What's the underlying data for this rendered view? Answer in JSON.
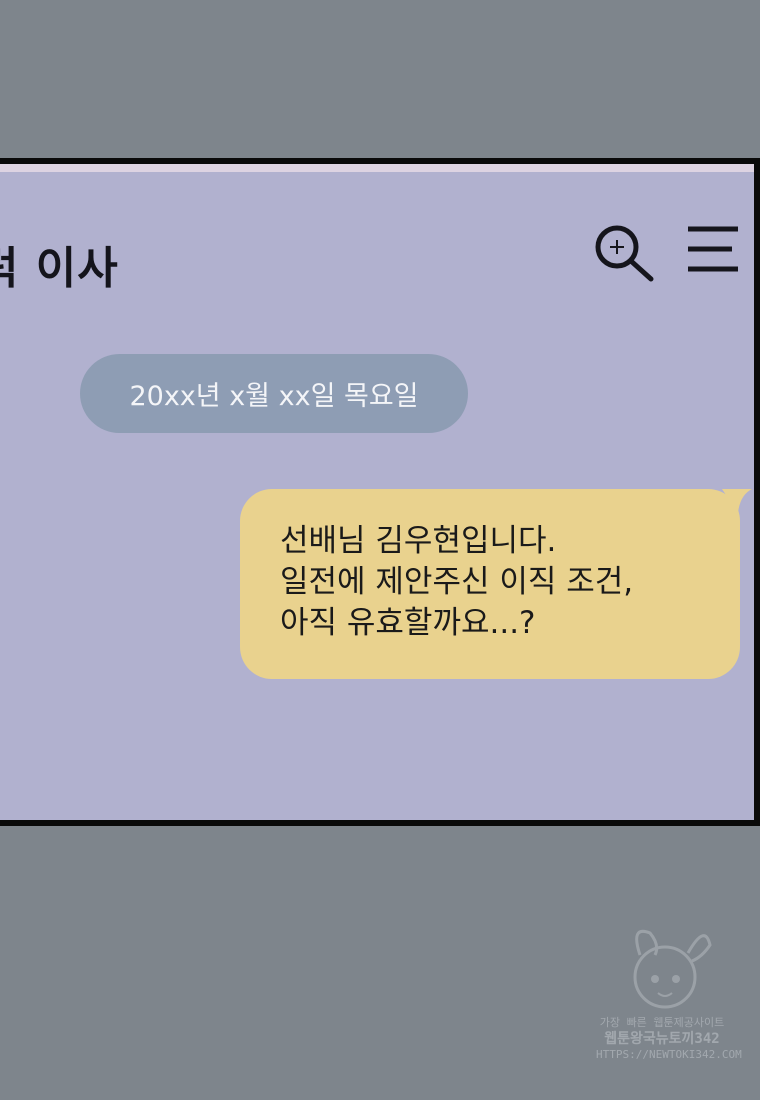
{
  "header": {
    "title": "럭 이사",
    "search_icon": "zoom-in-icon",
    "menu_icon": "hamburger-menu-icon"
  },
  "date_divider": {
    "text": "20xx년 x월 xx일 목요일"
  },
  "message": {
    "text": "선배님 김우현입니다.\n일전에 제안주신 이직 조건,\n아직 유효할까요...?",
    "bubble_color": "#e9d28e"
  },
  "colors": {
    "page_background": "#7e858c",
    "chat_background": "#b1b1cf",
    "date_pill": "#8e9db4"
  },
  "watermark": {
    "line1": "가장 빠른 웹툰제공사이트",
    "line2": "웹툰왕국뉴토끼342",
    "line3": "HTTPS://NEWTOKI342.COM"
  }
}
